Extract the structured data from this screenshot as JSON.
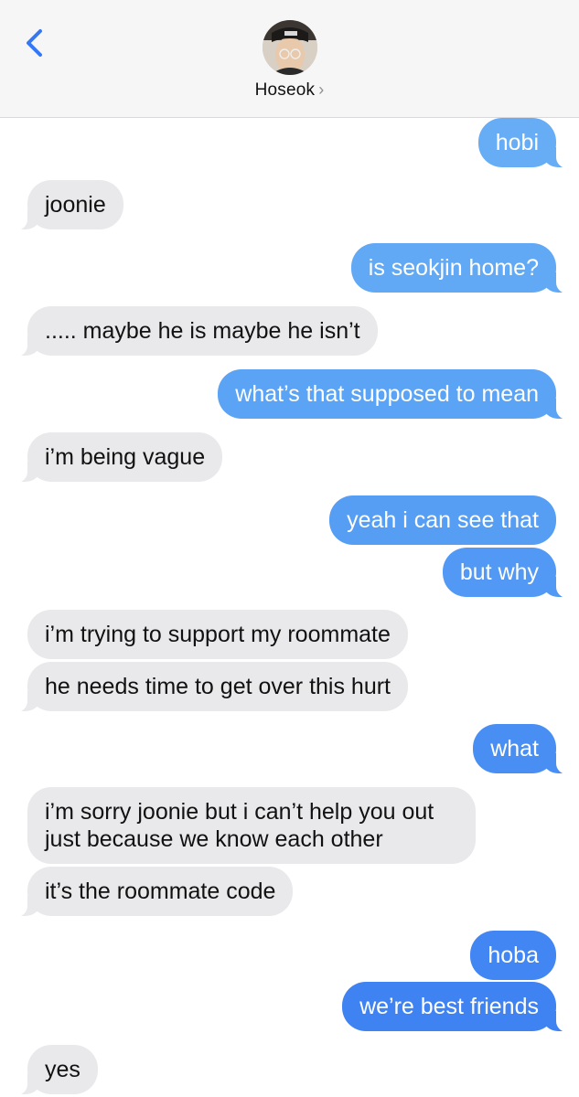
{
  "header": {
    "contact_name": "Hoseok",
    "chevron": "›",
    "back_icon": "chevron-left-icon",
    "accent_color": "#3478f6"
  },
  "messages": [
    {
      "from": "me",
      "text": "hobi"
    },
    {
      "from": "them",
      "text": "joonie"
    },
    {
      "from": "me",
      "text": "is seokjin home?"
    },
    {
      "from": "them",
      "text": "..... maybe he is maybe he isn’t"
    },
    {
      "from": "me",
      "text": "what’s that supposed to mean"
    },
    {
      "from": "them",
      "text": "i’m being vague"
    },
    {
      "from": "me",
      "text": "yeah i can see that"
    },
    {
      "from": "me",
      "text": "but why"
    },
    {
      "from": "them",
      "text": "i’m trying to support my roommate"
    },
    {
      "from": "them",
      "text": "he needs time to get over this hurt"
    },
    {
      "from": "me",
      "text": "what"
    },
    {
      "from": "them",
      "text": "i’m sorry joonie but i can’t help you out just because we know each other"
    },
    {
      "from": "them",
      "text": "it’s the roommate code"
    },
    {
      "from": "me",
      "text": "hoba"
    },
    {
      "from": "me",
      "text": "we’re best friends"
    },
    {
      "from": "them",
      "text": "yes"
    }
  ]
}
